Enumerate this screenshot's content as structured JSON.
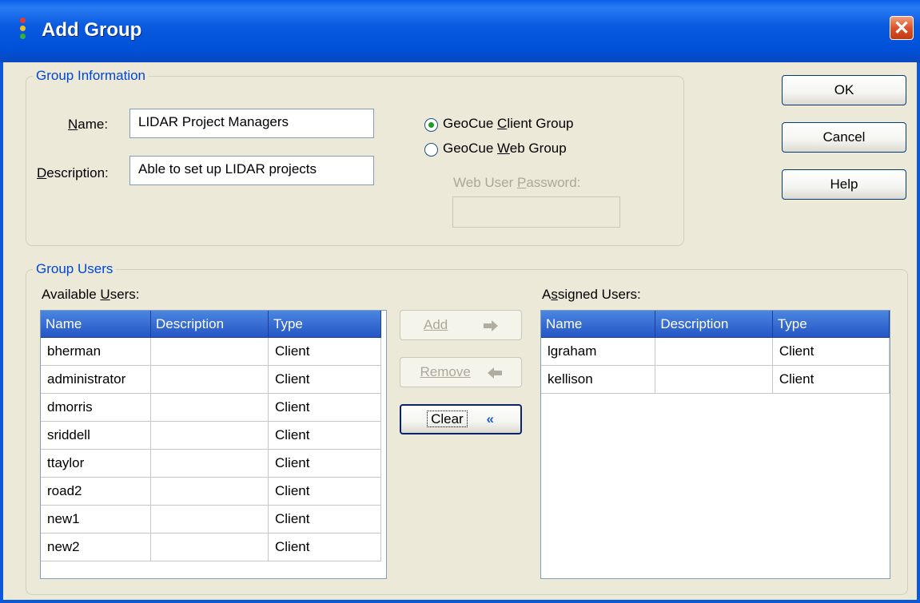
{
  "window": {
    "title": "Add Group"
  },
  "group_info": {
    "legend": "Group Information",
    "name_label": "Name:",
    "name_value": "LIDAR Project Managers",
    "description_label": "Description:",
    "description_value": "Able to set up LIDAR projects",
    "radio_client_label": "GeoCue Client Group",
    "radio_web_label": "GeoCue Web Group",
    "web_password_label": "Web User Password:",
    "selected_radio": "client"
  },
  "buttons": {
    "ok": "OK",
    "cancel": "Cancel",
    "help": "Help"
  },
  "group_users": {
    "legend": "Group Users",
    "available_label": "Available Users:",
    "assigned_label": "Assigned Users:",
    "columns": [
      "Name",
      "Description",
      "Type"
    ],
    "add_label": "Add",
    "remove_label": "Remove",
    "clear_label": "Clear",
    "available": [
      {
        "name": "bherman",
        "description": "",
        "type": "Client"
      },
      {
        "name": "administrator",
        "description": "",
        "type": "Client"
      },
      {
        "name": "dmorris",
        "description": "",
        "type": "Client"
      },
      {
        "name": "sriddell",
        "description": "",
        "type": "Client"
      },
      {
        "name": "ttaylor",
        "description": "",
        "type": "Client"
      },
      {
        "name": "road2",
        "description": "",
        "type": "Client"
      },
      {
        "name": "new1",
        "description": "",
        "type": "Client"
      },
      {
        "name": "new2",
        "description": "",
        "type": "Client"
      }
    ],
    "assigned": [
      {
        "name": "lgraham",
        "description": "",
        "type": "Client"
      },
      {
        "name": "kellison",
        "description": "",
        "type": "Client"
      }
    ]
  },
  "colors": {
    "title_bar": "#0a5fe8",
    "legend_text": "#0046d5",
    "list_header": "#2556c6"
  }
}
